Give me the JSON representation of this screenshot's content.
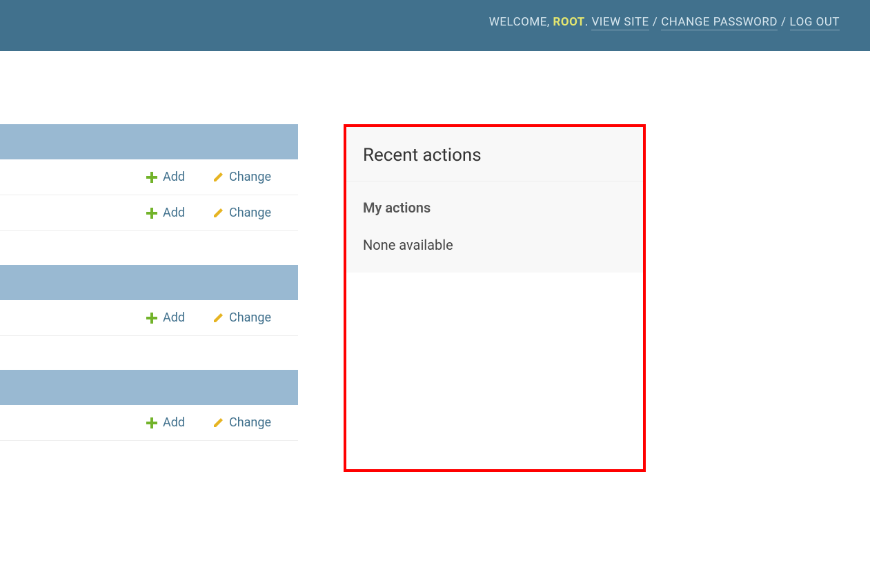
{
  "header": {
    "welcome_label": "WELCOME,",
    "username": "ROOT",
    "view_site": "VIEW SITE",
    "change_password": "CHANGE PASSWORD",
    "log_out": "LOG OUT",
    "dot": ".",
    "slash": "/"
  },
  "actions": {
    "add": "Add",
    "change": "Change"
  },
  "modules": [
    {
      "rows": 2
    },
    {
      "rows": 1
    },
    {
      "rows": 1
    }
  ],
  "sidebar": {
    "recent_title": "Recent actions",
    "my_actions": "My actions",
    "none": "None available"
  }
}
